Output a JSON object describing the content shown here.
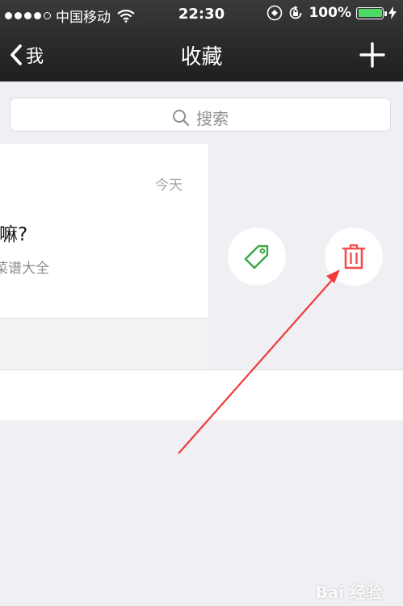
{
  "status_bar": {
    "carrier": "中国移动",
    "time": "22:30",
    "battery_percent_text": "100%",
    "battery_level": 1.0,
    "icons": [
      "signal-dots",
      "wifi-icon",
      "sync-icon",
      "rotation-lock-icon",
      "battery-icon",
      "charging-bolt-icon"
    ]
  },
  "nav": {
    "back_label": "我",
    "title": "收藏",
    "add_icon": "plus-icon"
  },
  "search": {
    "placeholder": "搜索"
  },
  "favorite_item": {
    "date": "今天",
    "title": "干嘛?",
    "source": "国菜谱大全"
  },
  "swipe_actions": {
    "tag": {
      "icon": "tag-icon",
      "color": "#3aa745"
    },
    "delete": {
      "icon": "trash-icon",
      "color": "#f24c4c"
    }
  },
  "annotation": {
    "arrow_color": "#f03a3a"
  },
  "watermark": {
    "text": "Bai 经验"
  }
}
